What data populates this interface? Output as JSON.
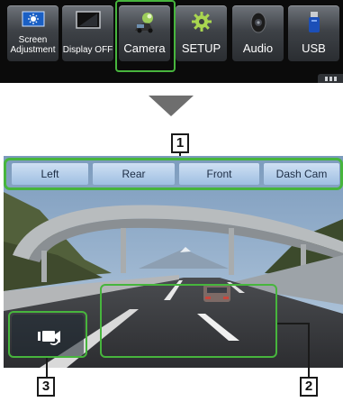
{
  "menu": {
    "items": [
      {
        "label_line1": "Screen",
        "label_line2": "Adjustment",
        "icon": "screen-adjustment-icon"
      },
      {
        "label_line1": "Display OFF",
        "label_line2": "",
        "icon": "display-off-icon"
      },
      {
        "label_line1": "Camera",
        "label_line2": "",
        "icon": "camera-icon"
      },
      {
        "label_line1": "SETUP",
        "label_line2": "",
        "icon": "gear-icon"
      },
      {
        "label_line1": "Audio",
        "label_line2": "",
        "icon": "speaker-icon"
      },
      {
        "label_line1": "USB",
        "label_line2": "",
        "icon": "usb-icon"
      }
    ],
    "selected": "Camera",
    "highlight_color": "#47b53d"
  },
  "camera_view": {
    "tabs": [
      "Left",
      "Rear",
      "Front",
      "Dash Cam"
    ],
    "switch_button_icon": "camera-switch-icon"
  },
  "callouts": {
    "tabs_number": "1",
    "view_area_number": "2",
    "camera_button_number": "3"
  }
}
